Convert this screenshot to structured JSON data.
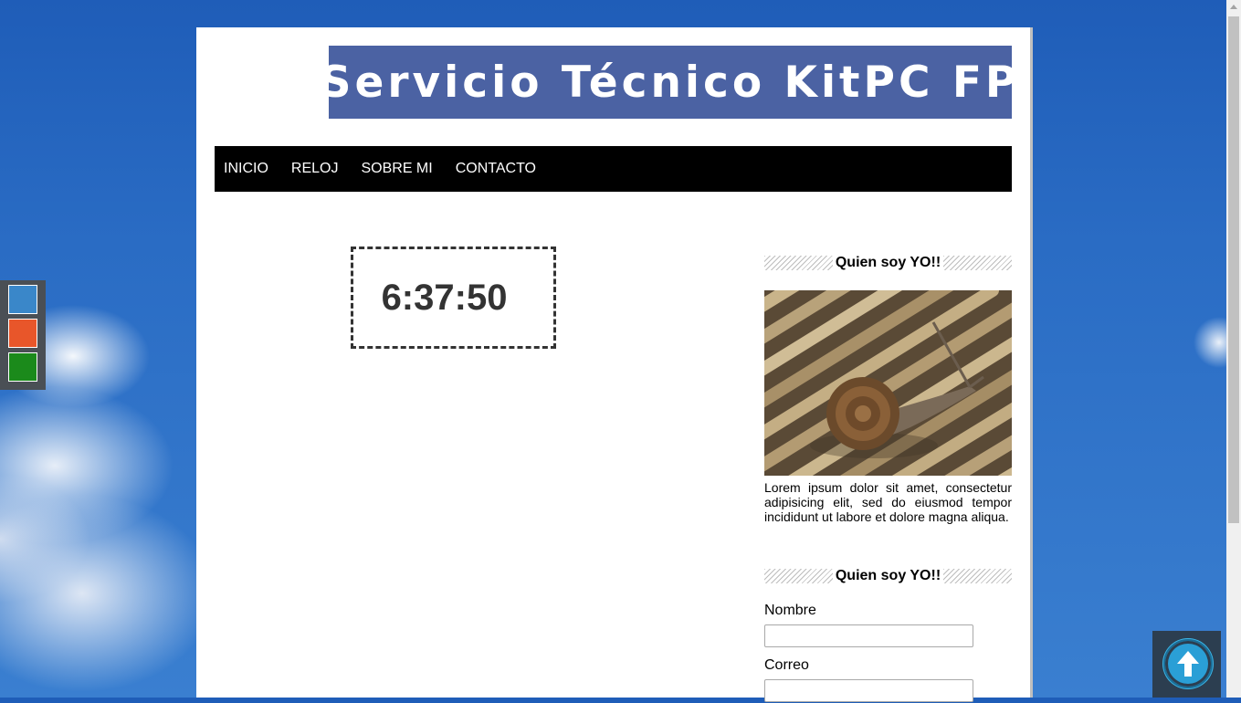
{
  "header": {
    "title": "Servicio Técnico KitPC FP"
  },
  "nav": {
    "items": [
      "INICIO",
      "RELOJ",
      "SOBRE MI",
      "CONTACTO"
    ]
  },
  "clock": {
    "time": "6:37:50"
  },
  "sidebar": {
    "about": {
      "heading": "Quien soy YO!!",
      "text": "Lorem ipsum dolor sit amet, consectetur adipisicing elit, sed do eiusmod tempor incididunt ut labore et dolore magna aliqua."
    },
    "contact": {
      "heading": "Quien soy YO!!",
      "name_label": "Nombre",
      "name_value": "",
      "email_label": "Correo",
      "email_value": ""
    }
  },
  "theme_switcher": {
    "colors": [
      "#3a87c9",
      "#e8562a",
      "#1b8a1b"
    ]
  },
  "colors": {
    "banner": "#4b62a3",
    "navbar": "#000000",
    "back_to_top": "#2a9fd6"
  },
  "icons": {
    "back_to_top": "arrow-up-icon"
  }
}
